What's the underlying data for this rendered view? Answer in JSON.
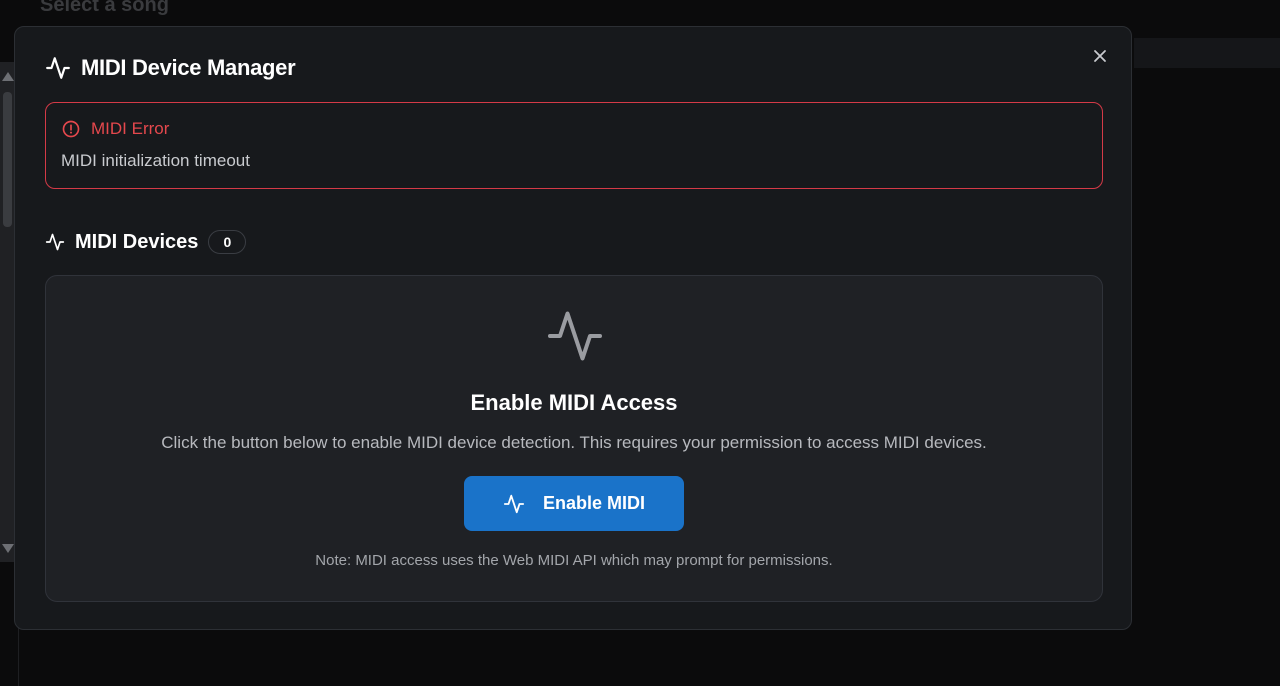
{
  "background": {
    "page_title": "Select a song"
  },
  "modal": {
    "title": "MIDI Device Manager",
    "close_icon": "close-icon",
    "title_icon": "activity-icon"
  },
  "error": {
    "title": "MIDI Error",
    "message": "MIDI initialization timeout",
    "icon": "alert-circle-icon",
    "color": "#e5484d"
  },
  "devices": {
    "title": "MIDI Devices",
    "count": "0",
    "icon": "activity-icon"
  },
  "empty_state": {
    "icon": "activity-icon",
    "title": "Enable MIDI Access",
    "description": "Click the button below to enable MIDI device detection. This requires your permission to access MIDI devices.",
    "button_label": "Enable MIDI",
    "button_icon": "activity-icon",
    "button_color": "#1a73c9",
    "note": "Note: MIDI access uses the Web MIDI API which may prompt for permissions."
  }
}
